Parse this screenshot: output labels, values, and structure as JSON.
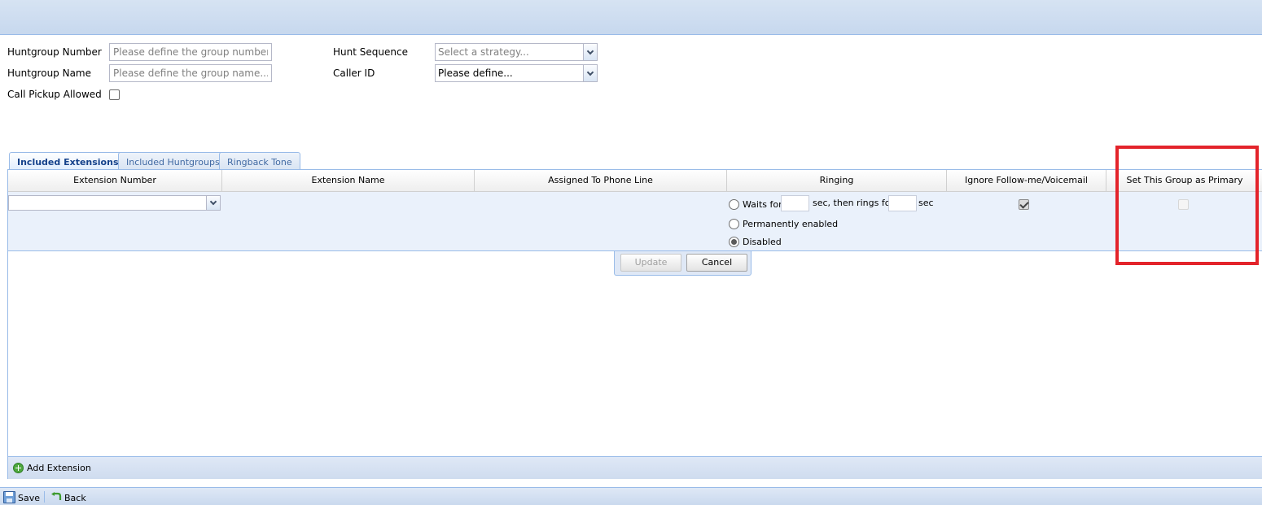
{
  "form": {
    "huntgroup_number_label": "Huntgroup Number",
    "huntgroup_number_placeholder": "Please define the group number...",
    "huntgroup_name_label": "Huntgroup Name",
    "huntgroup_name_placeholder": "Please define the group name...",
    "call_pickup_label": "Call Pickup Allowed",
    "call_pickup_checked": false,
    "hunt_sequence_label": "Hunt Sequence",
    "hunt_sequence_placeholder": "Select a strategy...",
    "caller_id_label": "Caller ID",
    "caller_id_value": "Please define..."
  },
  "tabs": [
    {
      "label": "Included Extensions",
      "active": true
    },
    {
      "label": "Included Huntgroups",
      "active": false
    },
    {
      "label": "Ringback Tone",
      "active": false
    }
  ],
  "grid": {
    "columns": [
      "Extension Number",
      "Extension Name",
      "Assigned To Phone Line",
      "Ringing",
      "Ignore Follow-me/Voicemail",
      "Set This Group as Primary"
    ],
    "editor": {
      "ringing": {
        "waits_for": "Waits for",
        "then_rings_for": "sec, then rings for",
        "sec": "sec",
        "permanently_enabled": "Permanently enabled",
        "disabled": "Disabled",
        "selected": "disabled"
      },
      "ignore_followme_checked": true,
      "set_primary_checked": false,
      "set_primary_enabled": false
    },
    "buttons": {
      "update": "Update",
      "cancel": "Cancel"
    },
    "footer": {
      "add_extension": "Add Extension"
    }
  },
  "toolbar": {
    "save": "Save",
    "back": "Back"
  },
  "colors": {
    "highlight": "#e3242b",
    "accent_border": "#99bbe8",
    "tab_active_text": "#15428b"
  }
}
